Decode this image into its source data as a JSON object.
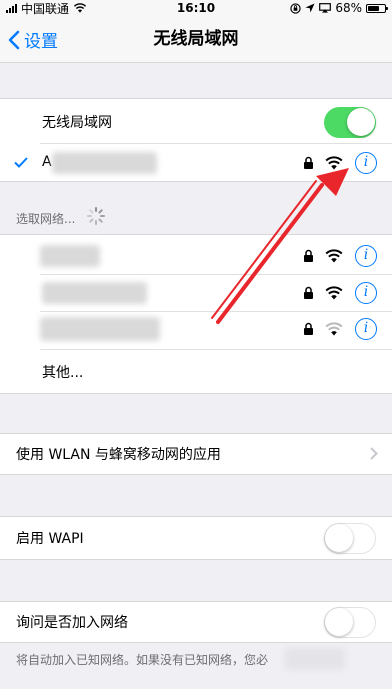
{
  "status_bar": {
    "carrier": "中国联通",
    "time": "16:10",
    "battery": "68%",
    "battery_level": 0.68
  },
  "nav": {
    "back_label": "设置",
    "title": "无线局域网"
  },
  "wlan": {
    "label": "无线局域网",
    "enabled": true
  },
  "connected_network": {
    "name_visible": "A",
    "connected": true
  },
  "choose_network": {
    "label": "选取网络..."
  },
  "networks": [
    {
      "locked": true
    },
    {
      "locked": true
    },
    {
      "locked": true
    }
  ],
  "other_label": "其他...",
  "wlan_apps_label": "使用 WLAN 与蜂窝移动网的应用",
  "wapi": {
    "label": "启用 WAPI",
    "enabled": false
  },
  "ask_join": {
    "label": "询问是否加入网络",
    "enabled": false,
    "footer": "将自动加入已知网络。如果没有已知网络，您必"
  },
  "colors": {
    "accent": "#007aff",
    "toggle_on": "#4cd964",
    "arrow": "#e8262b"
  }
}
